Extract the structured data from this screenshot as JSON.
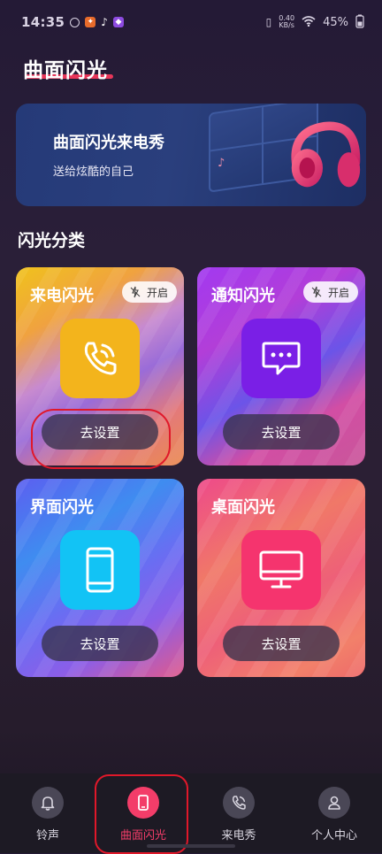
{
  "status_bar": {
    "time": "14:35",
    "network_speed_top": "0.40",
    "network_speed_unit": "KB/s",
    "battery": "45%"
  },
  "page_title": "曲面闪光",
  "banner": {
    "title": "曲面闪光来电秀",
    "subtitle": "送给炫酷的自己"
  },
  "section_title": "闪光分类",
  "cards": [
    {
      "title": "来电闪光",
      "toggle": "开启",
      "button": "去设置",
      "icon": "phone-call-icon",
      "color": "#f3b41c"
    },
    {
      "title": "通知闪光",
      "toggle": "开启",
      "button": "去设置",
      "icon": "message-icon",
      "color": "#7a1fe6"
    },
    {
      "title": "界面闪光",
      "button": "去设置",
      "icon": "smartphone-icon",
      "color": "#12c3f5"
    },
    {
      "title": "桌面闪光",
      "button": "去设置",
      "icon": "monitor-icon",
      "color": "#f5346e"
    }
  ],
  "bottom_nav": [
    {
      "label": "铃声",
      "icon": "bell-icon"
    },
    {
      "label": "曲面闪光",
      "icon": "phone-screen-icon",
      "active": true
    },
    {
      "label": "来电秀",
      "icon": "phone-call-icon"
    },
    {
      "label": "个人中心",
      "icon": "user-icon"
    }
  ]
}
